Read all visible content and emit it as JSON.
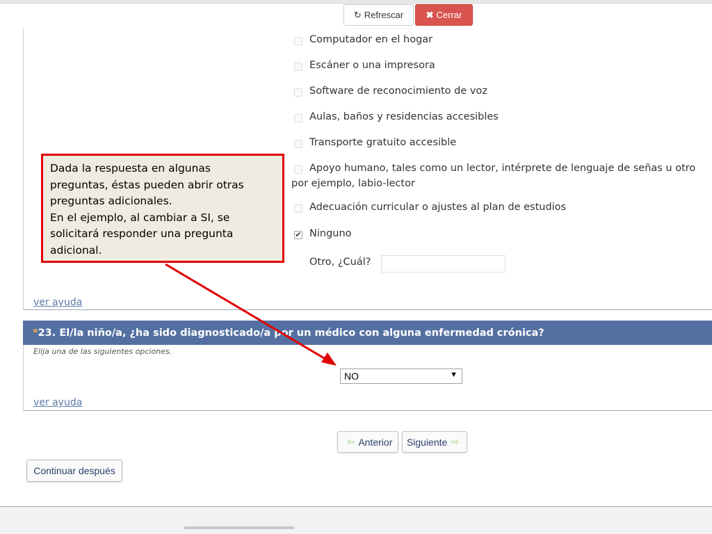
{
  "toolbar": {
    "refresh_label": "Refrescar",
    "close_label": "Cerrar",
    "refresh_icon": "refresh-icon",
    "close_icon": "close-icon"
  },
  "question_22": {
    "options": [
      {
        "label": "Computador en el hogar",
        "checked": false
      },
      {
        "label": "Escáner o una impresora",
        "checked": false
      },
      {
        "label": "Software de reconocimiento de voz",
        "checked": false
      },
      {
        "label": "Aulas, baños y residencias accesibles",
        "checked": false
      },
      {
        "label": "Transporte gratuito accesible",
        "checked": false
      },
      {
        "label": "Apoyo humano, tales como un lector, intérprete de lenguaje de señas u otro",
        "label_continued": "por ejemplo, labio-lector",
        "checked": false
      },
      {
        "label": "Adecuación curricular o ajustes al plan de estudios",
        "checked": false
      },
      {
        "label": "Ninguno",
        "checked": true
      }
    ],
    "other_label": "Otro, ¿Cuál?",
    "other_value": "",
    "help_link": "ver ayuda"
  },
  "question_23": {
    "required_mark": "*",
    "title": "23. El/la niño/a, ¿ha sido diagnosticado/a por un médico con alguna enfermedad crónica?",
    "hint": "Elija una de las siguientes opciones.",
    "selected": "NO",
    "help_link": "ver ayuda"
  },
  "navigation": {
    "prev_label": "Anterior",
    "next_label": "Siguiente",
    "later_label": "Continuar después"
  },
  "callout": {
    "lines": [
      "Dada la respuesta en algunas",
      "preguntas, éstas pueden abrir otras",
      "preguntas adicionales.",
      "En el ejemplo, al cambiar a SI, se",
      "solicitará responder una pregunta",
      "adicional."
    ]
  },
  "colors": {
    "header_bg": "#5470a2",
    "close_bg": "#d9534f",
    "callout_border": "#e00000",
    "callout_bg": "#eeece1",
    "link": "#5b7aa8"
  }
}
